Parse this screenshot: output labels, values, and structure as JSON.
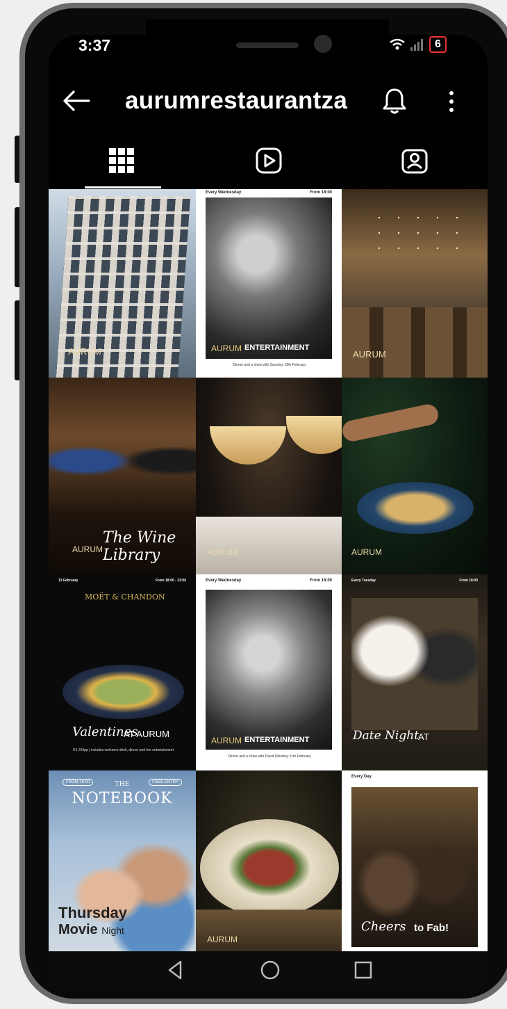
{
  "status": {
    "time": "3:37",
    "battery": "6"
  },
  "header": {
    "username": "aurumrestaurantza"
  },
  "tabs": [
    {
      "name": "posts-grid",
      "icon": "grid-icon",
      "active": true
    },
    {
      "name": "reels",
      "icon": "reels-play-icon",
      "active": false
    },
    {
      "name": "tagged",
      "icon": "tagged-person-icon",
      "active": false
    }
  ],
  "posts": {
    "p1": {
      "logo": "AURUM"
    },
    "p2": {
      "top_left": "Every Wednesday",
      "top_right": "From 18:00",
      "brand": "AURUM",
      "title": "ENTERTAINMENT",
      "caption": "Dinner and a show with Saxoboy 18th February"
    },
    "p3": {
      "logo": "AURUM"
    },
    "p4": {
      "script": "The Wine Library",
      "logo": "AURUM"
    },
    "p5": {
      "logo": "AURUM"
    },
    "p6": {
      "logo": "AURUM"
    },
    "p7": {
      "top_left": "13 February",
      "top_right": "From 18:00 - 23:00",
      "brand": "MOËT & CHANDON",
      "script": "Valentines",
      "title": "AT AURUM",
      "caption": "R1 250pp | includes welcome drink, dinner and live entertainment"
    },
    "p8": {
      "top_left": "Every Wednesday",
      "top_right": "From 18:00",
      "brand": "AURUM",
      "title": "ENTERTAINMENT",
      "caption": "Dinner and a show with David Delomey 11th February"
    },
    "p9": {
      "top_left": "Every Tuesday",
      "top_right": "From 18:00",
      "script": "Date Night",
      "title": "AT"
    },
    "p10": {
      "badge_left": "FROM 18:00",
      "badge_right": "FREE ENTRY",
      "pre": "THE",
      "title": "NOTEBOOK",
      "line1": "Thursday",
      "line2": "Movie",
      "line2b": "Night"
    },
    "p11": {
      "logo": "AURUM"
    },
    "p12": {
      "top_left": "Every Day",
      "script": "Cheers",
      "title": "to Fab!"
    }
  },
  "navigation": {
    "back": "back-triangle-icon",
    "home": "home-circle-icon",
    "recents": "recents-square-icon"
  }
}
